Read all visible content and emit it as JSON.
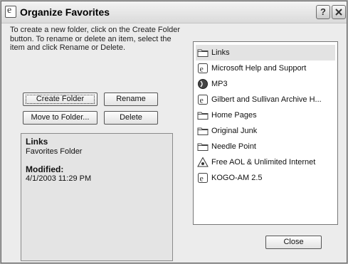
{
  "window": {
    "title": "Organize Favorites",
    "help_label": "?"
  },
  "description": "To create a new folder, click on the Create Folder button. To rename or delete an item, select the item and click Rename or Delete.",
  "buttons": {
    "create_folder": "Create Folder",
    "rename": "Rename",
    "move_to_folder": "Move to Folder...",
    "delete": "Delete",
    "close": "Close"
  },
  "properties": {
    "name": "Links",
    "type": "Favorites Folder",
    "modified_heading": "Modified:",
    "modified_value": "4/1/2003 11:29 PM"
  },
  "favorites": [
    {
      "label": "Links",
      "icon": "folder-icon",
      "selected": true
    },
    {
      "label": "Microsoft Help and Support",
      "icon": "ie-page-icon"
    },
    {
      "label": "MP3",
      "icon": "media-icon"
    },
    {
      "label": "Gilbert and Sullivan Archive H...",
      "icon": "ie-page-icon"
    },
    {
      "label": "Home Pages",
      "icon": "folder-icon"
    },
    {
      "label": "Original Junk",
      "icon": "folder-icon"
    },
    {
      "label": "Needle Point",
      "icon": "folder-icon"
    },
    {
      "label": "Free AOL & Unlimited Internet",
      "icon": "aol-icon"
    },
    {
      "label": "KOGO-AM 2.5",
      "icon": "ie-page-icon"
    }
  ]
}
